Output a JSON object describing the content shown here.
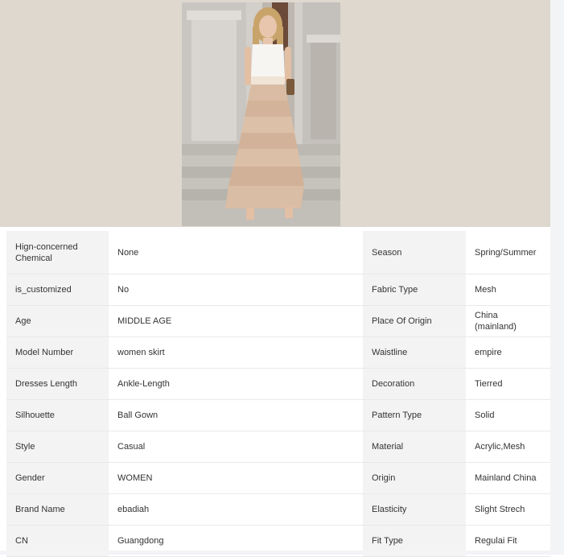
{
  "image": {
    "alt": "Model in white top and tiered beige tulle maxi skirt"
  },
  "specs": [
    {
      "label1": "Hign-concerned Chemical",
      "value1": "None",
      "label2": "Season",
      "value2": "Spring/Summer"
    },
    {
      "label1": "is_customized",
      "value1": "No",
      "label2": "Fabric Type",
      "value2": "Mesh"
    },
    {
      "label1": "Age",
      "value1": "MIDDLE AGE",
      "label2": "Place Of Origin",
      "value2": "China (mainland)"
    },
    {
      "label1": "Model Number",
      "value1": "women skirt",
      "label2": "Waistline",
      "value2": "empire"
    },
    {
      "label1": "Dresses Length",
      "value1": "Ankle-Length",
      "label2": "Decoration",
      "value2": "Tierred"
    },
    {
      "label1": "Silhouette",
      "value1": "Ball Gown",
      "label2": "Pattern Type",
      "value2": "Solid"
    },
    {
      "label1": "Style",
      "value1": "Casual",
      "label2": "Material",
      "value2": "Acrylic,Mesh"
    },
    {
      "label1": "Gender",
      "value1": "WOMEN",
      "label2": "Origin",
      "value2": "Mainland China"
    },
    {
      "label1": "Brand Name",
      "value1": "ebadiah",
      "label2": "Elasticity",
      "value2": "Slight Strech"
    },
    {
      "label1": "CN",
      "value1": "Guangdong",
      "label2": "Fit Type",
      "value2": "Regulai Fit"
    }
  ]
}
